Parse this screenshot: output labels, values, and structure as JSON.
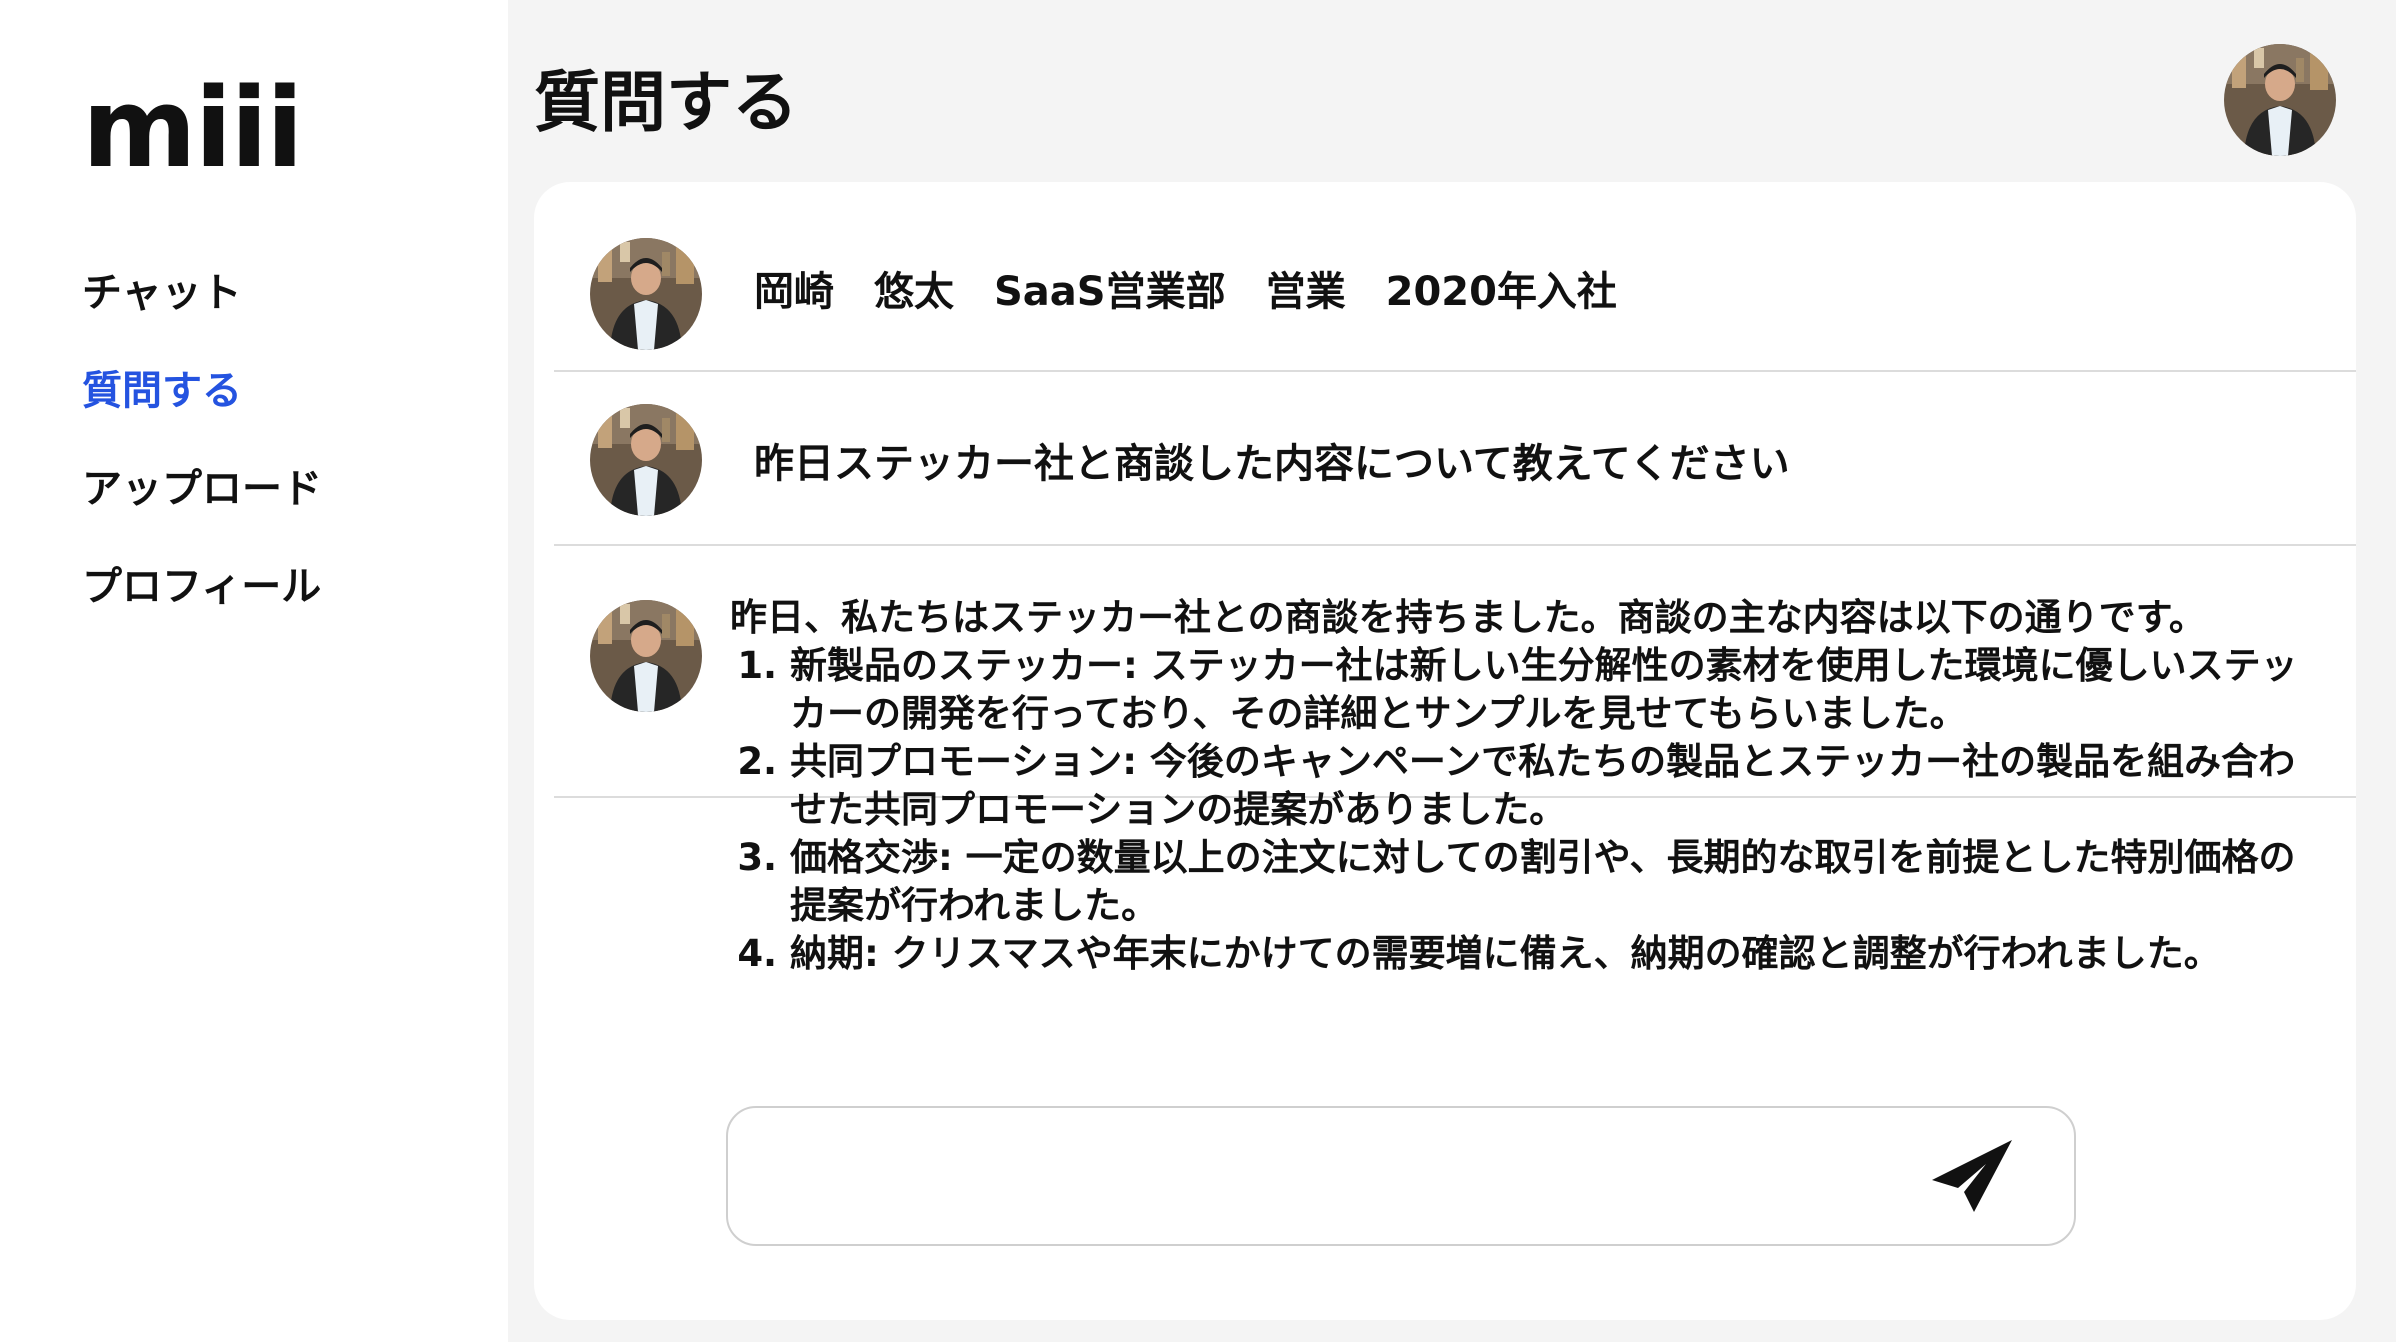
{
  "app": {
    "logo": "miii"
  },
  "sidebar": {
    "items": [
      {
        "label": "チャット"
      },
      {
        "label": "質問する"
      },
      {
        "label": "アップロード"
      },
      {
        "label": "プロフィール"
      }
    ],
    "active_index": 1
  },
  "header": {
    "title": "質問する"
  },
  "profile": {
    "name": "岡崎　悠太",
    "department": "SaaS営業部",
    "role": "営業",
    "joined": "2020年入社"
  },
  "question": {
    "text": "昨日ステッカー社と商談した内容について教えてください"
  },
  "answer": {
    "intro": "昨日、私たちはステッカー社との商談を持ちました。商談の主な内容は以下の通りです。",
    "items": [
      "新製品のステッカー: ステッカー社は新しい生分解性の素材を使用した環境に優しいステッカーの開発を行っており、その詳細とサンプルを見せてもらいました。",
      "共同プロモーション: 今後のキャンペーンで私たちの製品とステッカー社の製品を組み合わせた共同プロモーションの提案がありました。",
      "価格交渉: 一定の数量以上の注文に対しての割引や、長期的な取引を前提とした特別価格の提案が行われました。",
      "納期: クリスマスや年末にかけての需要増に備え、納期の確認と調整が行われました。"
    ]
  },
  "composer": {
    "value": "",
    "placeholder": ""
  },
  "icons": {
    "send": "send-icon",
    "avatar": "avatar-photo"
  },
  "colors": {
    "accent": "#2453e0",
    "background": "#f4f4f4",
    "card": "#ffffff",
    "text": "#111111"
  }
}
